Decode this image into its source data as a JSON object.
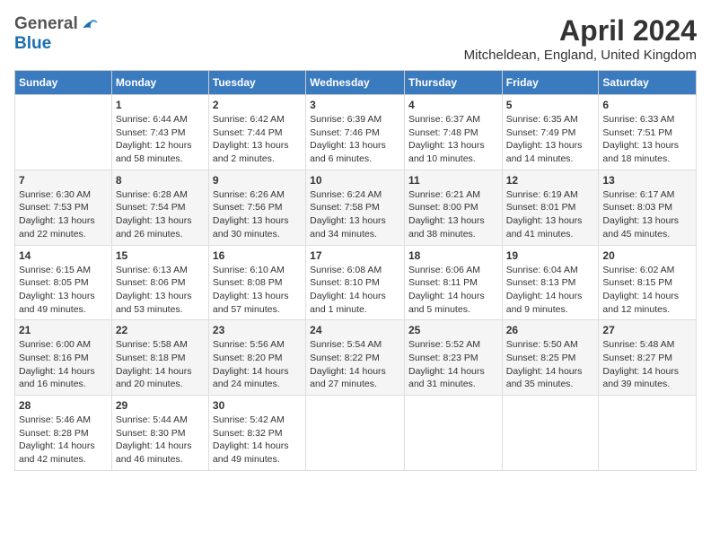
{
  "header": {
    "logo_general": "General",
    "logo_blue": "Blue",
    "month_title": "April 2024",
    "location": "Mitcheldean, England, United Kingdom"
  },
  "calendar": {
    "days_of_week": [
      "Sunday",
      "Monday",
      "Tuesday",
      "Wednesday",
      "Thursday",
      "Friday",
      "Saturday"
    ],
    "weeks": [
      [
        {
          "day": "",
          "info": ""
        },
        {
          "day": "1",
          "info": "Sunrise: 6:44 AM\nSunset: 7:43 PM\nDaylight: 12 hours\nand 58 minutes."
        },
        {
          "day": "2",
          "info": "Sunrise: 6:42 AM\nSunset: 7:44 PM\nDaylight: 13 hours\nand 2 minutes."
        },
        {
          "day": "3",
          "info": "Sunrise: 6:39 AM\nSunset: 7:46 PM\nDaylight: 13 hours\nand 6 minutes."
        },
        {
          "day": "4",
          "info": "Sunrise: 6:37 AM\nSunset: 7:48 PM\nDaylight: 13 hours\nand 10 minutes."
        },
        {
          "day": "5",
          "info": "Sunrise: 6:35 AM\nSunset: 7:49 PM\nDaylight: 13 hours\nand 14 minutes."
        },
        {
          "day": "6",
          "info": "Sunrise: 6:33 AM\nSunset: 7:51 PM\nDaylight: 13 hours\nand 18 minutes."
        }
      ],
      [
        {
          "day": "7",
          "info": "Sunrise: 6:30 AM\nSunset: 7:53 PM\nDaylight: 13 hours\nand 22 minutes."
        },
        {
          "day": "8",
          "info": "Sunrise: 6:28 AM\nSunset: 7:54 PM\nDaylight: 13 hours\nand 26 minutes."
        },
        {
          "day": "9",
          "info": "Sunrise: 6:26 AM\nSunset: 7:56 PM\nDaylight: 13 hours\nand 30 minutes."
        },
        {
          "day": "10",
          "info": "Sunrise: 6:24 AM\nSunset: 7:58 PM\nDaylight: 13 hours\nand 34 minutes."
        },
        {
          "day": "11",
          "info": "Sunrise: 6:21 AM\nSunset: 8:00 PM\nDaylight: 13 hours\nand 38 minutes."
        },
        {
          "day": "12",
          "info": "Sunrise: 6:19 AM\nSunset: 8:01 PM\nDaylight: 13 hours\nand 41 minutes."
        },
        {
          "day": "13",
          "info": "Sunrise: 6:17 AM\nSunset: 8:03 PM\nDaylight: 13 hours\nand 45 minutes."
        }
      ],
      [
        {
          "day": "14",
          "info": "Sunrise: 6:15 AM\nSunset: 8:05 PM\nDaylight: 13 hours\nand 49 minutes."
        },
        {
          "day": "15",
          "info": "Sunrise: 6:13 AM\nSunset: 8:06 PM\nDaylight: 13 hours\nand 53 minutes."
        },
        {
          "day": "16",
          "info": "Sunrise: 6:10 AM\nSunset: 8:08 PM\nDaylight: 13 hours\nand 57 minutes."
        },
        {
          "day": "17",
          "info": "Sunrise: 6:08 AM\nSunset: 8:10 PM\nDaylight: 14 hours\nand 1 minute."
        },
        {
          "day": "18",
          "info": "Sunrise: 6:06 AM\nSunset: 8:11 PM\nDaylight: 14 hours\nand 5 minutes."
        },
        {
          "day": "19",
          "info": "Sunrise: 6:04 AM\nSunset: 8:13 PM\nDaylight: 14 hours\nand 9 minutes."
        },
        {
          "day": "20",
          "info": "Sunrise: 6:02 AM\nSunset: 8:15 PM\nDaylight: 14 hours\nand 12 minutes."
        }
      ],
      [
        {
          "day": "21",
          "info": "Sunrise: 6:00 AM\nSunset: 8:16 PM\nDaylight: 14 hours\nand 16 minutes."
        },
        {
          "day": "22",
          "info": "Sunrise: 5:58 AM\nSunset: 8:18 PM\nDaylight: 14 hours\nand 20 minutes."
        },
        {
          "day": "23",
          "info": "Sunrise: 5:56 AM\nSunset: 8:20 PM\nDaylight: 14 hours\nand 24 minutes."
        },
        {
          "day": "24",
          "info": "Sunrise: 5:54 AM\nSunset: 8:22 PM\nDaylight: 14 hours\nand 27 minutes."
        },
        {
          "day": "25",
          "info": "Sunrise: 5:52 AM\nSunset: 8:23 PM\nDaylight: 14 hours\nand 31 minutes."
        },
        {
          "day": "26",
          "info": "Sunrise: 5:50 AM\nSunset: 8:25 PM\nDaylight: 14 hours\nand 35 minutes."
        },
        {
          "day": "27",
          "info": "Sunrise: 5:48 AM\nSunset: 8:27 PM\nDaylight: 14 hours\nand 39 minutes."
        }
      ],
      [
        {
          "day": "28",
          "info": "Sunrise: 5:46 AM\nSunset: 8:28 PM\nDaylight: 14 hours\nand 42 minutes."
        },
        {
          "day": "29",
          "info": "Sunrise: 5:44 AM\nSunset: 8:30 PM\nDaylight: 14 hours\nand 46 minutes."
        },
        {
          "day": "30",
          "info": "Sunrise: 5:42 AM\nSunset: 8:32 PM\nDaylight: 14 hours\nand 49 minutes."
        },
        {
          "day": "",
          "info": ""
        },
        {
          "day": "",
          "info": ""
        },
        {
          "day": "",
          "info": ""
        },
        {
          "day": "",
          "info": ""
        }
      ]
    ]
  }
}
